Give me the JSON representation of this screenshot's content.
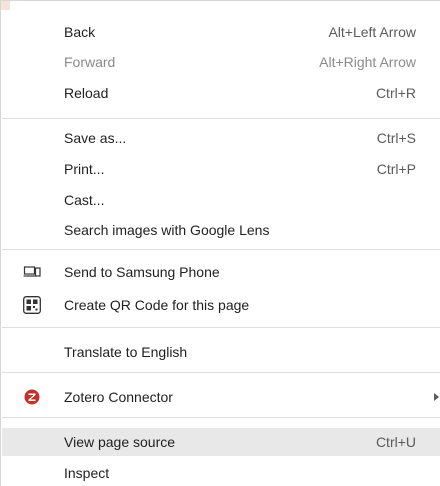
{
  "menu": {
    "items": [
      {
        "id": "back",
        "label": "Back",
        "shortcut": "Alt+Left Arrow"
      },
      {
        "id": "forward",
        "label": "Forward",
        "shortcut": "Alt+Right Arrow"
      },
      {
        "id": "reload",
        "label": "Reload",
        "shortcut": "Ctrl+R"
      },
      {
        "id": "save-as",
        "label": "Save as...",
        "shortcut": "Ctrl+S"
      },
      {
        "id": "print",
        "label": "Print...",
        "shortcut": "Ctrl+P"
      },
      {
        "id": "cast",
        "label": "Cast...",
        "shortcut": ""
      },
      {
        "id": "search-images",
        "label": "Search images with Google Lens",
        "shortcut": ""
      },
      {
        "id": "send-to-phone",
        "label": "Send to Samsung Phone",
        "shortcut": "",
        "icon": "send-to-device-icon"
      },
      {
        "id": "create-qr",
        "label": "Create QR Code for this page",
        "shortcut": "",
        "icon": "qr-code-icon"
      },
      {
        "id": "translate",
        "label": "Translate to English",
        "shortcut": ""
      },
      {
        "id": "zotero",
        "label": "Zotero Connector",
        "shortcut": "",
        "icon": "zotero-icon",
        "submenu": "chevron-right-icon"
      },
      {
        "id": "view-source",
        "label": "View page source",
        "shortcut": "Ctrl+U"
      },
      {
        "id": "inspect",
        "label": "Inspect",
        "shortcut": ""
      }
    ]
  },
  "colors": {
    "hover_background": "#e8e8e8",
    "disabled_text": "#8a8a8a",
    "zotero_red": "#c4302b"
  }
}
